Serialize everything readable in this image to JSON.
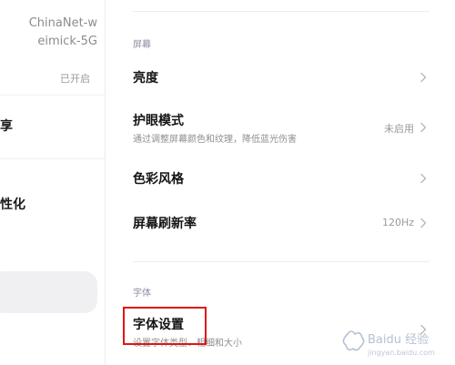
{
  "network": {
    "wifi_name_line1": "ChinaNet-w",
    "wifi_name_line2": "eimick-5G",
    "status": "已开启"
  },
  "left_menu": {
    "item_cut_1": "享",
    "item_cut_2": "性化"
  },
  "display": {
    "section_label": "屏幕",
    "rows": [
      {
        "title": "亮度",
        "subtitle": "",
        "value": ""
      },
      {
        "title": "护眼模式",
        "subtitle": "通过调整屏幕颜色和纹理，降低蓝光伤害",
        "value": "未启用"
      },
      {
        "title": "色彩风格",
        "subtitle": "",
        "value": ""
      },
      {
        "title": "屏幕刷新率",
        "subtitle": "",
        "value": "120Hz"
      }
    ]
  },
  "font": {
    "section_label": "字体",
    "row": {
      "title": "字体设置",
      "subtitle": "设置字体类型、粗细和大小"
    }
  },
  "highlight_color": "#e01515",
  "watermark": {
    "text": "Baidu 经验",
    "subtext": "jingyan.baidu.com"
  },
  "icons": {
    "chevron": "chevron-right-icon"
  }
}
